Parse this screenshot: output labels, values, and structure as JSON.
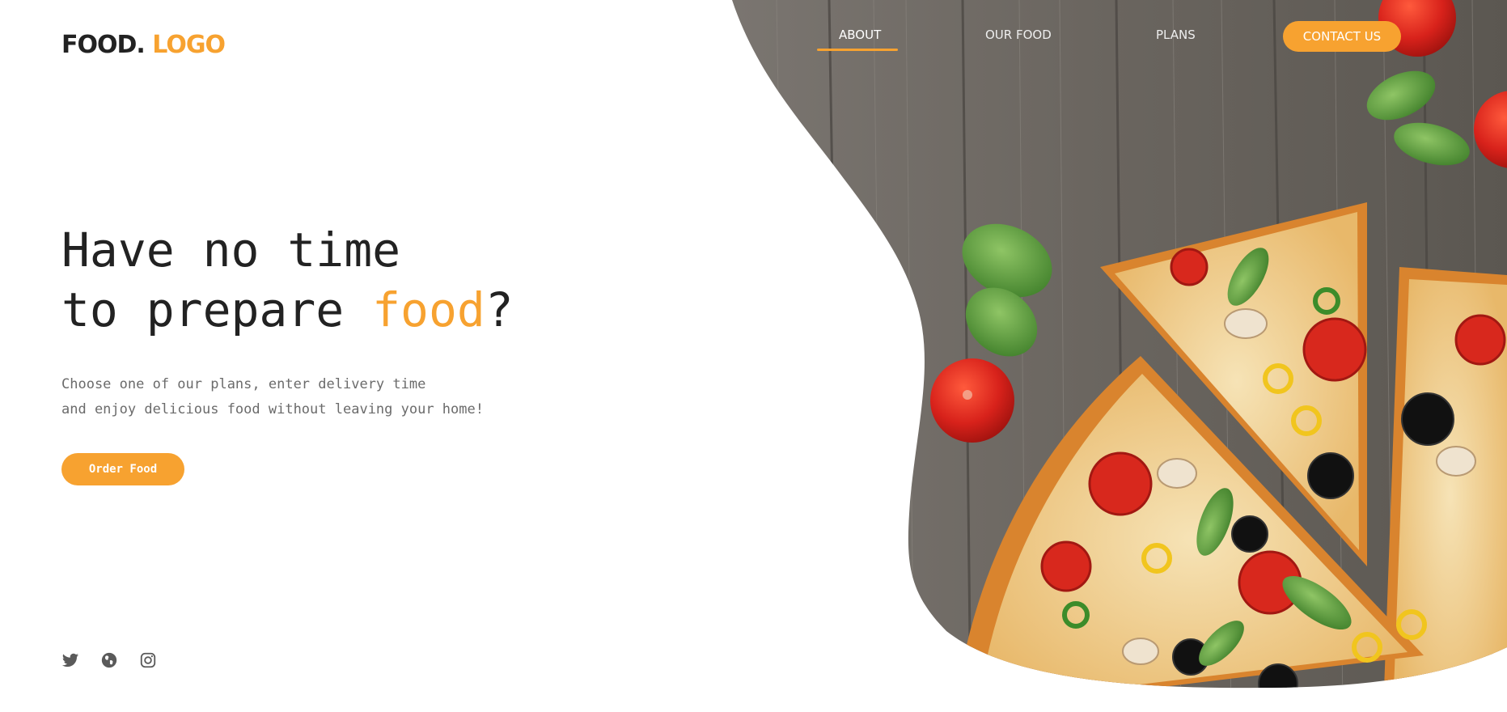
{
  "logo": {
    "text_main": "FOOD.",
    "text_accent": "LOGO"
  },
  "nav": {
    "items": [
      {
        "label": "ABOUT",
        "active": true
      },
      {
        "label": "OUR FOOD",
        "active": false
      },
      {
        "label": "PLANS",
        "active": false
      }
    ],
    "contact_label": "CONTACT US"
  },
  "hero": {
    "headline_line1": "Have no time",
    "headline_line2_prefix": "to prepare ",
    "headline_line2_accent": "food",
    "headline_line2_suffix": "?",
    "subtext_line1": "Choose one of our plans, enter delivery time",
    "subtext_line2": "and enjoy delicious food without leaving your home!",
    "order_button": "Order Food"
  },
  "social": [
    {
      "icon": "twitter-icon"
    },
    {
      "icon": "globe-icon"
    },
    {
      "icon": "instagram-icon"
    }
  ],
  "colors": {
    "accent": "#f7a230",
    "text_dark": "#222222",
    "text_muted": "#6b6b6b",
    "wood": "#6f6b66"
  }
}
